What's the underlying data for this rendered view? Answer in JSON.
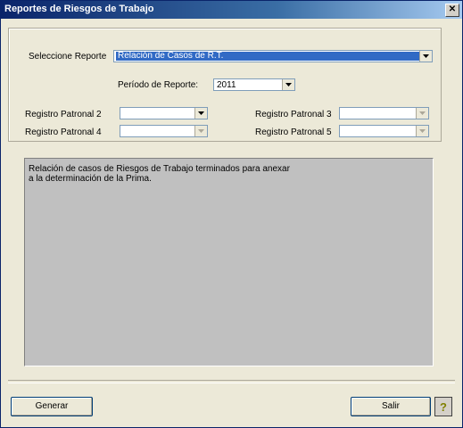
{
  "window": {
    "title": "Reportes de Riesgos de Trabajo",
    "close_glyph": "✕"
  },
  "form": {
    "report_label": "Seleccione Reporte",
    "report_value": "Relación de Casos de R.T.",
    "period_label": "Período de Reporte:",
    "period_value": "2011",
    "reg2_label": "Registro Patronal 2",
    "reg3_label": "Registro Patronal 3",
    "reg4_label": "Registro Patronal 4",
    "reg5_label": "Registro Patronal 5",
    "reg2_value": "",
    "reg3_value": "",
    "reg4_value": "",
    "reg5_value": ""
  },
  "description": {
    "line1": "Relación de casos de Riesgos de Trabajo terminados para anexar",
    "line2": "a la determinación de la Prima."
  },
  "buttons": {
    "generate_label": "Generar",
    "exit_label": "Salir",
    "help_glyph": "?"
  },
  "colors": {
    "title_start": "#0a246a",
    "title_end": "#a6caf0",
    "selection": "#316ac5",
    "description_bg": "#c0c0c0"
  },
  "icons": {
    "close": "close-icon",
    "dropdown": "chevron-down-icon",
    "help": "help-icon"
  }
}
